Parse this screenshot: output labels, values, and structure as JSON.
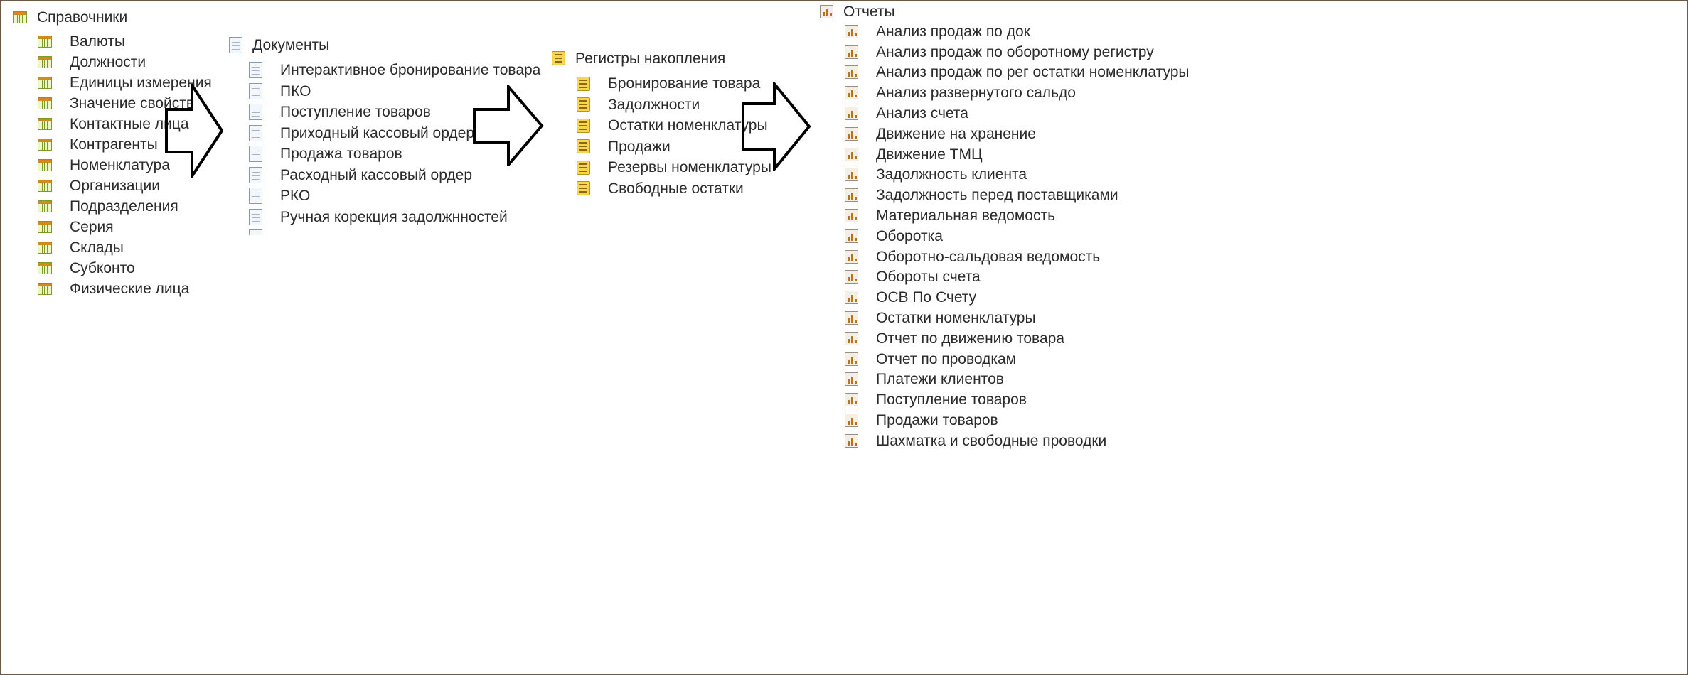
{
  "catalogs": {
    "title": "Справочники",
    "icon": "catalog-icon",
    "items": [
      "Валюты",
      "Должности",
      "Единицы измерения",
      "Значение свойств",
      "Контактные лица",
      "Контрагенты",
      "Номенклатура",
      "Организации",
      "Подразделения",
      "Серия",
      "Склады",
      "Субконто",
      "Физические лица"
    ]
  },
  "documents": {
    "title": "Документы",
    "icon": "document-icon",
    "items": [
      "Интерактивное бронирование товара",
      "ПКО",
      "Поступление товаров",
      "Приходный кассовый ордер",
      "Продажа товаров",
      "Расходный кассовый ордер",
      "РКО",
      "Ручная корекция задолжнностей"
    ]
  },
  "registers": {
    "title": "Регистры накопления",
    "icon": "register-icon",
    "items": [
      "Бронирование товара",
      "Задолжности",
      "Остатки номенклатуры",
      "Продажи",
      "Резервы номенклатуры",
      "Свободные остатки"
    ]
  },
  "reports": {
    "title": "Отчеты",
    "icon": "report-icon",
    "items": [
      "Анализ продаж по док",
      "Анализ продаж по оборотному регистру",
      "Анализ продаж по рег остатки номенклатуры",
      "Анализ развернутого сальдо",
      "Анализ счета",
      "Движение на хранение",
      "Движение ТМЦ",
      "Задолжность клиента",
      "Задолжность перед поставщиками",
      "Материальная ведомость",
      "Оборотка",
      "Оборотно-сальдовая ведомость",
      "Обороты счета",
      "ОСВ По Счету",
      "Остатки номенклатуры",
      "Отчет по движению товара",
      "Отчет по проводкам",
      "Платежи клиентов",
      "Поступление товаров",
      "Продажи товаров",
      "Шахматка и свободные проводки"
    ]
  },
  "colors": {
    "text": "#2b2b2b",
    "frame": "#6b5a4a",
    "arrow": "#000000"
  }
}
